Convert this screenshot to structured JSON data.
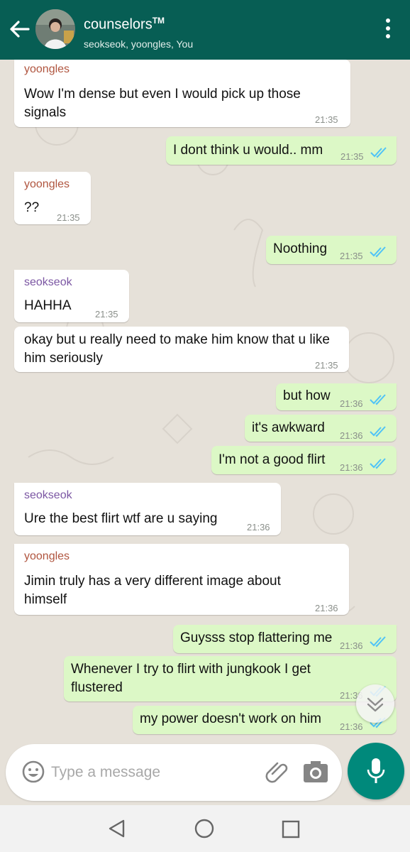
{
  "header": {
    "title": "counselors",
    "title_mark": "TM",
    "subtitle": "seokseok, yoongles, You"
  },
  "messages": [
    {
      "dir": "in",
      "sender": "yoongles",
      "text": "Wow I'm dense but even I would pick up those signals",
      "time": "21:35"
    },
    {
      "dir": "out",
      "text": "I dont think u would.. mm",
      "time": "21:35",
      "status": "read"
    },
    {
      "dir": "in",
      "sender": "yoongles",
      "text": "??",
      "time": "21:35"
    },
    {
      "dir": "out",
      "text": "Noothing",
      "time": "21:35",
      "status": "read"
    },
    {
      "dir": "in",
      "sender": "seokseok",
      "text": "HAHHA",
      "time": "21:35"
    },
    {
      "dir": "in",
      "text": "okay but u really need to make him know that u like him seriously",
      "time": "21:35"
    },
    {
      "dir": "out",
      "text": "but how",
      "time": "21:36",
      "status": "read"
    },
    {
      "dir": "out",
      "text": "it's awkward",
      "time": "21:36",
      "status": "read"
    },
    {
      "dir": "out",
      "text": "I'm not a good flirt",
      "time": "21:36",
      "status": "read"
    },
    {
      "dir": "in",
      "sender": "seokseok",
      "text": "Ure the best flirt wtf are u saying",
      "time": "21:36"
    },
    {
      "dir": "in",
      "sender": "yoongles",
      "text": "Jimin truly has a very different image about himself",
      "time": "21:36"
    },
    {
      "dir": "out",
      "text": "Guysss stop flattering me",
      "time": "21:36",
      "status": "read"
    },
    {
      "dir": "out",
      "text": "Whenever I try to flirt with jungkook I get flustered",
      "time": "21:36",
      "status": "read"
    },
    {
      "dir": "out",
      "text": "my power doesn't work on him",
      "time": "21:36",
      "status": "read"
    }
  ],
  "composer": {
    "placeholder": "Type a message"
  },
  "colors": {
    "header": "#075e54",
    "outgoing_bubble": "#dcf8c6",
    "incoming_bubble": "#ffffff",
    "read_ticks": "#4fc3f7",
    "mic_button": "#00897b",
    "sender_yoongles": "#b0553f",
    "sender_seokseok": "#7b56a3"
  },
  "icons": [
    "back-arrow-icon",
    "avatar",
    "more-vert-icon",
    "double-check-icon",
    "scroll-down-icon",
    "emoji-icon",
    "attach-icon",
    "camera-icon",
    "mic-icon",
    "nav-back-icon",
    "nav-home-icon",
    "nav-recent-icon"
  ]
}
